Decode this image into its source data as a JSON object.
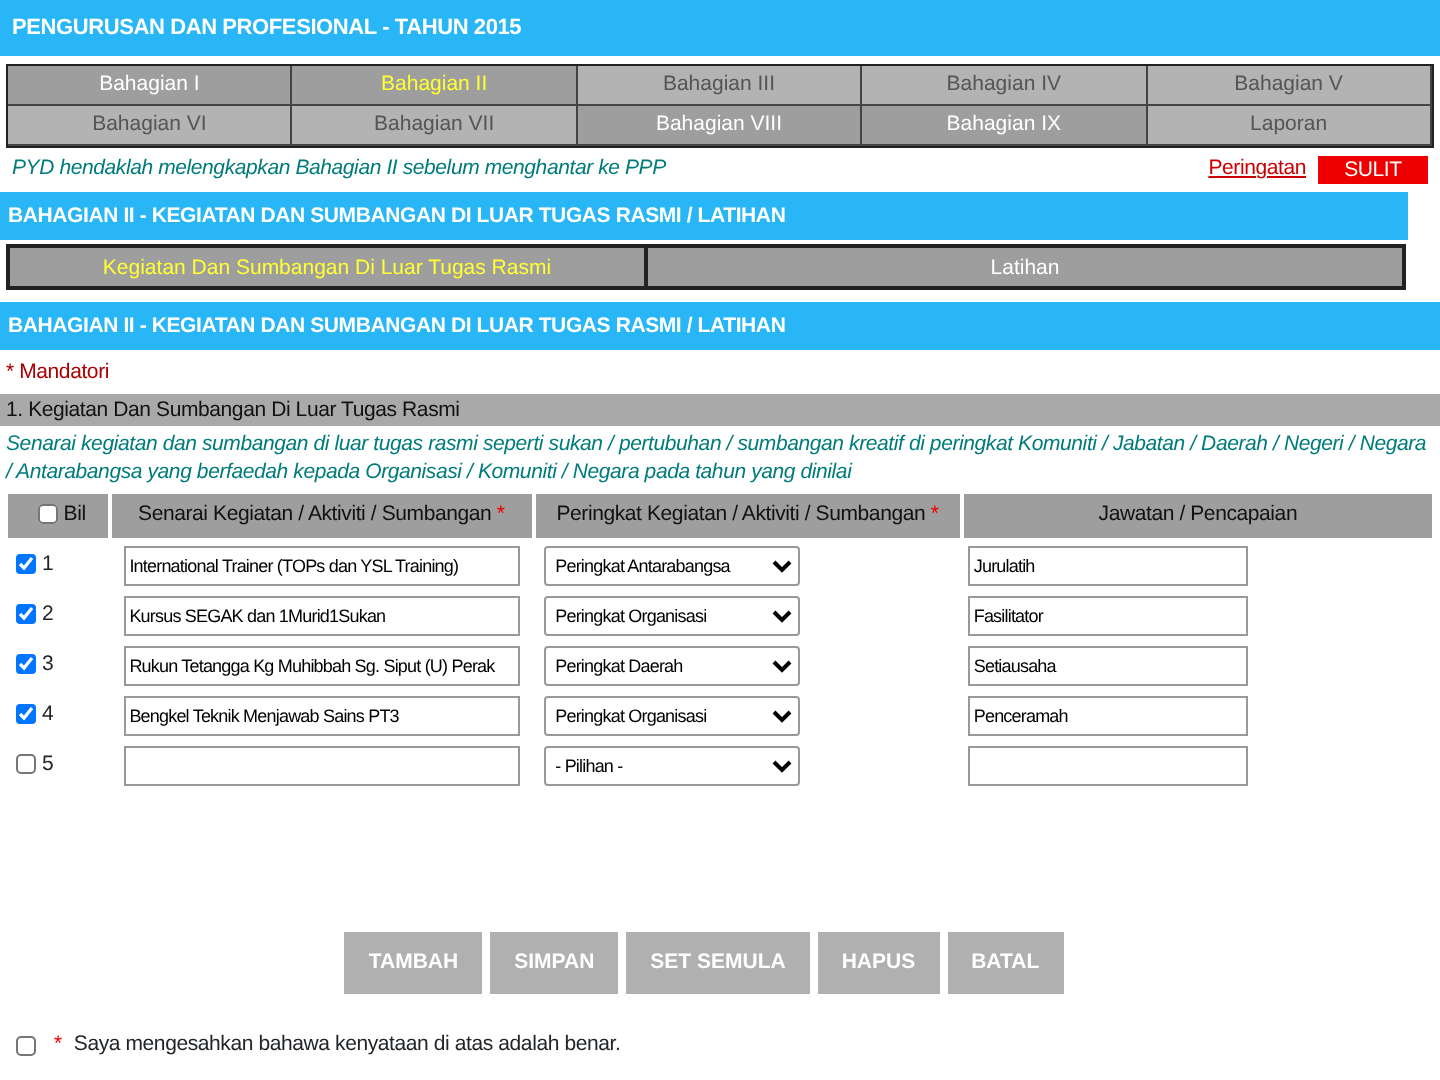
{
  "header": {
    "title": "PENGURUSAN DAN PROFESIONAL - TAHUN 2015"
  },
  "part_tabs": [
    {
      "label": "Bahagian I",
      "selected": false,
      "disabled": false
    },
    {
      "label": "Bahagian II",
      "selected": true,
      "disabled": false
    },
    {
      "label": "Bahagian III",
      "selected": false,
      "disabled": true
    },
    {
      "label": "Bahagian IV",
      "selected": false,
      "disabled": true
    },
    {
      "label": "Bahagian V",
      "selected": false,
      "disabled": true
    },
    {
      "label": "Bahagian VI",
      "selected": false,
      "disabled": true
    },
    {
      "label": "Bahagian VII",
      "selected": false,
      "disabled": true
    },
    {
      "label": "Bahagian VIII",
      "selected": false,
      "disabled": false
    },
    {
      "label": "Bahagian IX",
      "selected": false,
      "disabled": false
    },
    {
      "label": "Laporan",
      "selected": false,
      "disabled": true
    }
  ],
  "notice": {
    "text": "PYD hendaklah melengkapkan Bahagian II sebelum menghantar ke PPP",
    "link": "Peringatan",
    "badge": "SULIT"
  },
  "section_title": "BAHAGIAN II - KEGIATAN DAN SUMBANGAN DI LUAR TUGAS RASMI / LATIHAN",
  "sub_tabs": [
    {
      "label": "Kegiatan Dan Sumbangan Di Luar Tugas Rasmi",
      "selected": true
    },
    {
      "label": "Latihan",
      "selected": false
    }
  ],
  "form_title": "BAHAGIAN II - KEGIATAN DAN SUMBANGAN DI LUAR TUGAS RASMI / LATIHAN",
  "mandatory_note": "* Mandatori",
  "subsection": "1. Kegiatan Dan Sumbangan Di Luar Tugas Rasmi",
  "description": "Senarai kegiatan dan sumbangan di luar tugas rasmi seperti sukan / pertubuhan / sumbangan kreatif di peringkat Komuniti / Jabatan / Daerah / Negeri / Negara / Antarabangsa yang berfaedah kepada Organisasi / Komuniti / Negara pada tahun yang dinilai",
  "table": {
    "select_all_checked": false,
    "columns": [
      {
        "label": "Bil"
      },
      {
        "label": "Senarai Kegiatan / Aktiviti / Sumbangan",
        "mark": "*"
      },
      {
        "label": "Peringkat Kegiatan / Aktiviti / Sumbangan",
        "mark": "*"
      },
      {
        "label": "Jawatan / Pencapaian"
      }
    ],
    "rows": [
      {
        "checked": true,
        "number": "1",
        "activity": "International Trainer (TOPs dan YSL Training)",
        "tier": "Peringkat Antarabangsa",
        "role": "Jurulatih"
      },
      {
        "checked": true,
        "number": "2",
        "activity": "Kursus SEGAK dan 1Murid1Sukan",
        "tier": "Peringkat Organisasi",
        "role": "Fasilitator"
      },
      {
        "checked": true,
        "number": "3",
        "activity": "Rukun Tetangga Kg Muhibbah Sg. Siput (U) Perak",
        "tier": "Peringkat Daerah",
        "role": "Setiausaha"
      },
      {
        "checked": true,
        "number": "4",
        "activity": "Bengkel Teknik Menjawab Sains PT3",
        "tier": "Peringkat Organisasi",
        "role": "Penceramah"
      },
      {
        "checked": false,
        "number": "5",
        "tier": "- Pilihan -"
      }
    ]
  },
  "buttons": [
    "TAMBAH",
    "SIMPAN",
    "SET SEMULA",
    "HAPUS",
    "BATAL"
  ],
  "confirm": {
    "checked": false,
    "mark": "*",
    "text": "Saya mengesahkan bahawa kenyataan di atas adalah benar."
  }
}
